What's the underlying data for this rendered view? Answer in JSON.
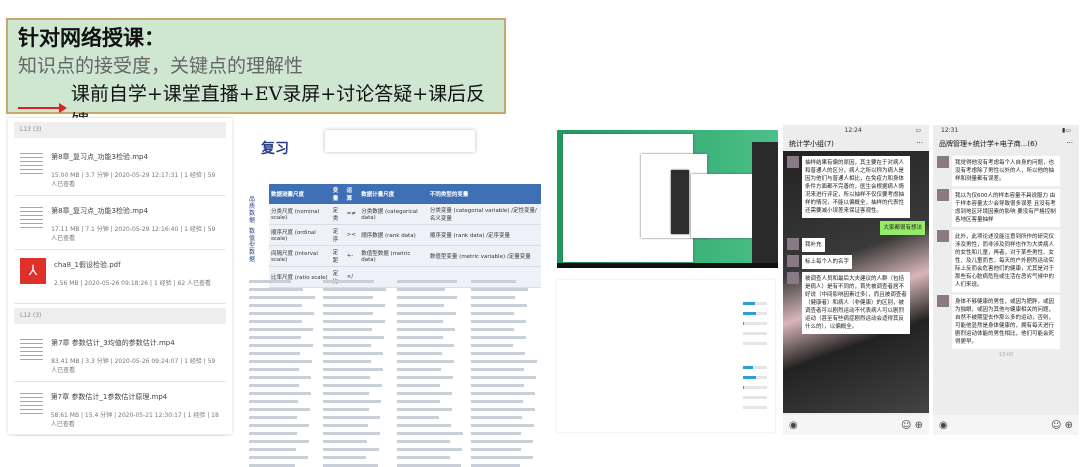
{
  "banner": {
    "title": "针对网络授课：",
    "subtitle": "知识点的接受度，关键点的理解性",
    "methods": "课前自学+课堂直播+EV录屏+讨论答疑+课后反馈",
    "arrow_color": "#e02020"
  },
  "files": {
    "sections": [
      {
        "label": "L13 (3)",
        "items": [
          {
            "name": "第8章_复习点_功能3检验.mp4",
            "meta": "15.00 MB | 3.7 分钟 | 2020-05-29 12:17:31 | 1 经验 | 59 人已查看",
            "type": "video"
          },
          {
            "name": "第8章_复习点_功能3检验.mp4",
            "meta": "17.11 MB | 7.1 分钟 | 2020-05-29 12:16:40 | 1 经验 | 59 人已查看",
            "type": "video"
          },
          {
            "name": "cha8_1假设检验.pdf",
            "meta": "2.56 MB | 2020-05-26 09:18:26 | 1 经验 | 62 人已查看",
            "type": "pdf"
          }
        ]
      },
      {
        "label": "L12 (3)",
        "items": [
          {
            "name": "第7章 参数估计_3均值的参数估计.mp4",
            "meta": "83.41 MB | 3.3 分钟 | 2020-05-26 09:24:07 | 1 经验 | 59 人已查看",
            "type": "video"
          },
          {
            "name": "第7章 参数估计_1参数估计原理.mp4",
            "meta": "58.61 MB | 15.4 分钟 | 2020-05-21 12:30:17 | 1 经验 | 18 人已查看",
            "type": "video"
          }
        ]
      }
    ]
  },
  "slide": {
    "title": "复习",
    "side_labels": [
      "品质数据",
      "数值型数据"
    ],
    "headers": [
      "数据测量尺度",
      "变量",
      "运算",
      "数据计量尺度",
      "不同类型的变量"
    ],
    "rows": [
      [
        "分类尺度 (nominal scale)",
        "定类",
        "=≠",
        "分类数据 (categorical data)",
        "分类变量 (categorial variable) /定性变量/名义变量"
      ],
      [
        "顺序尺度 (ordinal scale)",
        "定序",
        "><",
        "顺序数据 (rank data)",
        "顺序变量 (rank data) /定序变量"
      ],
      [
        "间隔尺度 (interval scale)",
        "定距",
        "+-",
        "数值型数据 (metric data)",
        "数值型变量 (metric variable) /定量变量"
      ],
      [
        "比率尺度 (ratio scale)",
        "定比",
        "×/",
        "",
        ""
      ]
    ]
  },
  "survey": {
    "questions": [
      {
        "options": [
          0.5,
          0.55,
          0.05,
          0,
          0
        ]
      },
      {
        "options": [
          0.4,
          0.55,
          0.05,
          0,
          0
        ]
      }
    ]
  },
  "chat1": {
    "time": "12:24",
    "title": "统计学小组(7)",
    "messages": [
      {
        "from": "other",
        "text": "抽样结果有偏的原因，其主要在于对病人和普通人的区分，病人之所以称为病人是因为他们与普通人相比，在免疫力和身体条件方面都不完善的，医生会根据病人情况来进行评定，所以抽样不仅仅要考虑抽样的情况，不能以偏概全，抽样的代表性还需要减小误差来保证客观性。"
      },
      {
        "from": "me",
        "text": "大家都很有想法"
      },
      {
        "from": "other",
        "text": "我补充"
      },
      {
        "from": "other",
        "text": "标上每个人的名字"
      },
      {
        "from": "other",
        "text": "被调查人员和最后大夫建议的人群（包括是病人）是有不同的，首先被调查者居不好说（中间影响因素过多），而且被调查者（健康者）和病人（非健康）的区别，被调查者可以剧烈运动不代表病人可以剧烈运动（甚至有些病症剧烈运动会适得其反什么的），以偏概全。"
      }
    ]
  },
  "chat2": {
    "time": "12:31",
    "title": "品牌管理+统计学+电子商...(6)",
    "messages": [
      {
        "from": "other",
        "text": "我觉得他没有考虑每个人自身的问题，也没有考虑除了男性以外的人，所以他的抽样和测量都有误差。"
      },
      {
        "from": "other",
        "text": "我以为仅600人的样本容量不具说服力 由于样本容量太少会导致很多误差 且没有考虑到地区环境因素的影响 要没有严格控制各地区客量抽样"
      },
      {
        "from": "other",
        "text": "此外，此项论述没能注意到所作的研究仅涉及男性，而非涉及同样也作为大类病人的女性和儿童，再者，对于某些男性、女性、及儿童而言，每天的户外剧烈运动实际上反而会危害他们的健康，尤其是对于那些有心脏病危险或生活在恶劣气候中的人们来说。"
      },
      {
        "from": "other",
        "text": "身体不够健康的男性，或因为肥胖，或因为独眼，或因为其他与健康相关的问题，自然不被期望去作那么多的运动，否则，可能他显然是身体健康的，拥有每天进行剧烈运动体能的男性相比，他们可能会死得更早。"
      },
      {
        "from": "time",
        "text": "13:00"
      }
    ]
  }
}
